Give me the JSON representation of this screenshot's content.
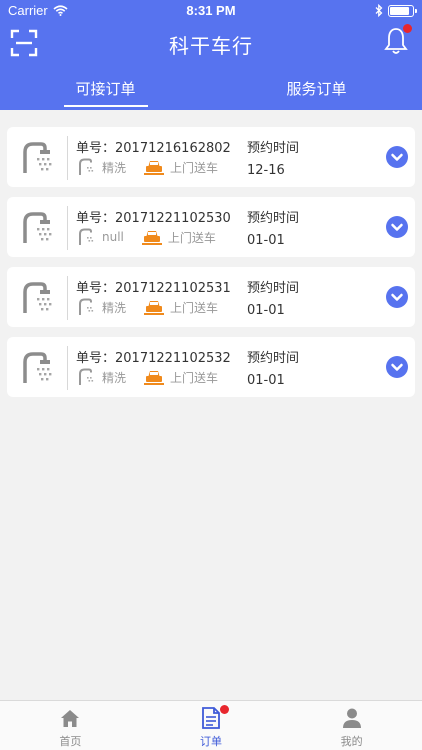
{
  "status_bar": {
    "carrier": "Carrier",
    "time": "8:31 PM"
  },
  "header": {
    "title": "科干车行"
  },
  "tabs": [
    {
      "label": "可接订单",
      "active": true
    },
    {
      "label": "服务订单",
      "active": false
    }
  ],
  "orders": [
    {
      "order_label": "单号：20171216162802",
      "service": "精洗",
      "delivery": "上门送车",
      "appt_label": "预约时间",
      "appt_value": "12-16"
    },
    {
      "order_label": "单号：20171221102530",
      "service": "null",
      "delivery": "上门送车",
      "appt_label": "预约时间",
      "appt_value": "01-01"
    },
    {
      "order_label": "单号：20171221102531",
      "service": "精洗",
      "delivery": "上门送车",
      "appt_label": "预约时间",
      "appt_value": "01-01"
    },
    {
      "order_label": "单号：20171221102532",
      "service": "精洗",
      "delivery": "上门送车",
      "appt_label": "预约时间",
      "appt_value": "01-01"
    }
  ],
  "tabbar": [
    {
      "label": "首页",
      "icon": "home-icon",
      "active": false
    },
    {
      "label": "订单",
      "icon": "orders-icon",
      "active": true
    },
    {
      "label": "我的",
      "icon": "profile-icon",
      "active": false
    }
  ],
  "colors": {
    "primary": "#5773ef",
    "badge": "#e8262d",
    "truck": "#f08a1c"
  }
}
